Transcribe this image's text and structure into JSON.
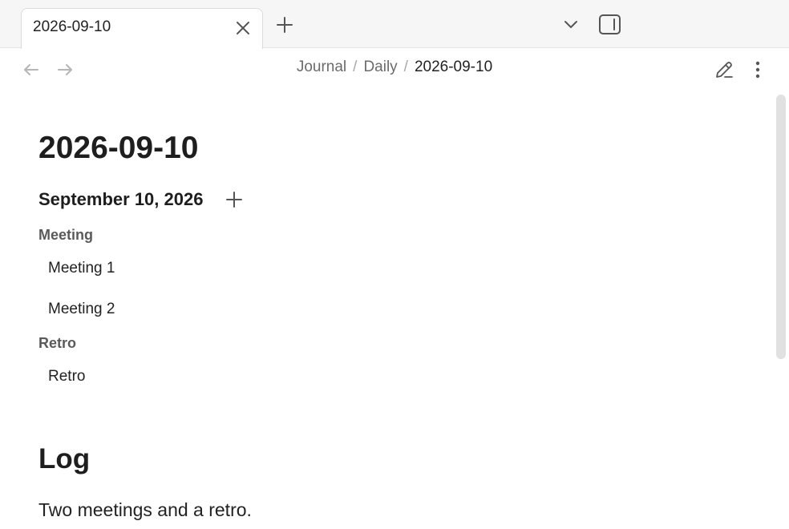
{
  "tab": {
    "title": "2026-09-10"
  },
  "breadcrumb": {
    "items": [
      "Journal",
      "Daily"
    ],
    "current": "2026-09-10"
  },
  "note": {
    "title": "2026-09-10",
    "date_heading": "September 10, 2026",
    "groups": [
      {
        "label": "Meeting",
        "entries": [
          "Meeting 1",
          "Meeting 2"
        ]
      },
      {
        "label": "Retro",
        "entries": [
          "Retro"
        ]
      }
    ],
    "log_heading": "Log",
    "log_text": "Two meetings and a retro."
  },
  "icons": {
    "tab_close": "close-icon",
    "new_tab": "plus-icon",
    "tab_list": "chevron-down-icon",
    "sidebar_toggle": "sidebar-right-icon",
    "back": "arrow-left-icon",
    "forward": "arrow-right-icon",
    "edit": "pencil-icon",
    "more": "more-vertical-icon",
    "add_entry": "plus-icon"
  },
  "colors": {
    "icon": "#555555",
    "icon_disabled": "#b5b5b5",
    "text": "#222222",
    "muted": "#6b6b6b"
  }
}
